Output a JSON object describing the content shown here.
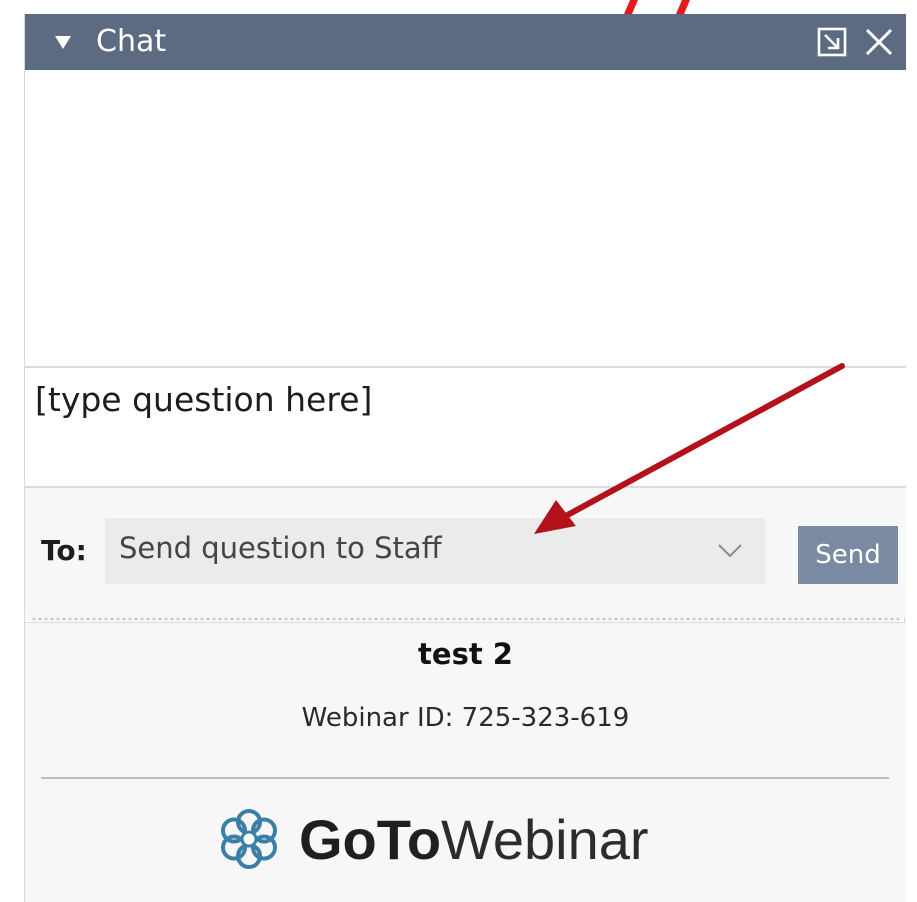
{
  "chat": {
    "title": "Chat",
    "header_color": "#5c6b81"
  },
  "question": {
    "placeholder": "[type question here]",
    "value": ""
  },
  "recipient": {
    "label": "To:",
    "selected": "Send question to Staff"
  },
  "send_label": "Send",
  "webinar": {
    "title": "test 2",
    "id_text": "Webinar ID: 725-323-619"
  },
  "brand": {
    "bold": "GoTo",
    "light": "Webinar",
    "logo_color": "#3a7fa8"
  },
  "annotation": {
    "arrow_color": "#b3121c"
  },
  "icons": {
    "collapse": "triangle-down-icon",
    "popout": "popout-icon",
    "close": "close-icon",
    "dropdown": "chevron-down-icon",
    "logo": "gotowebinar-logo-icon"
  }
}
